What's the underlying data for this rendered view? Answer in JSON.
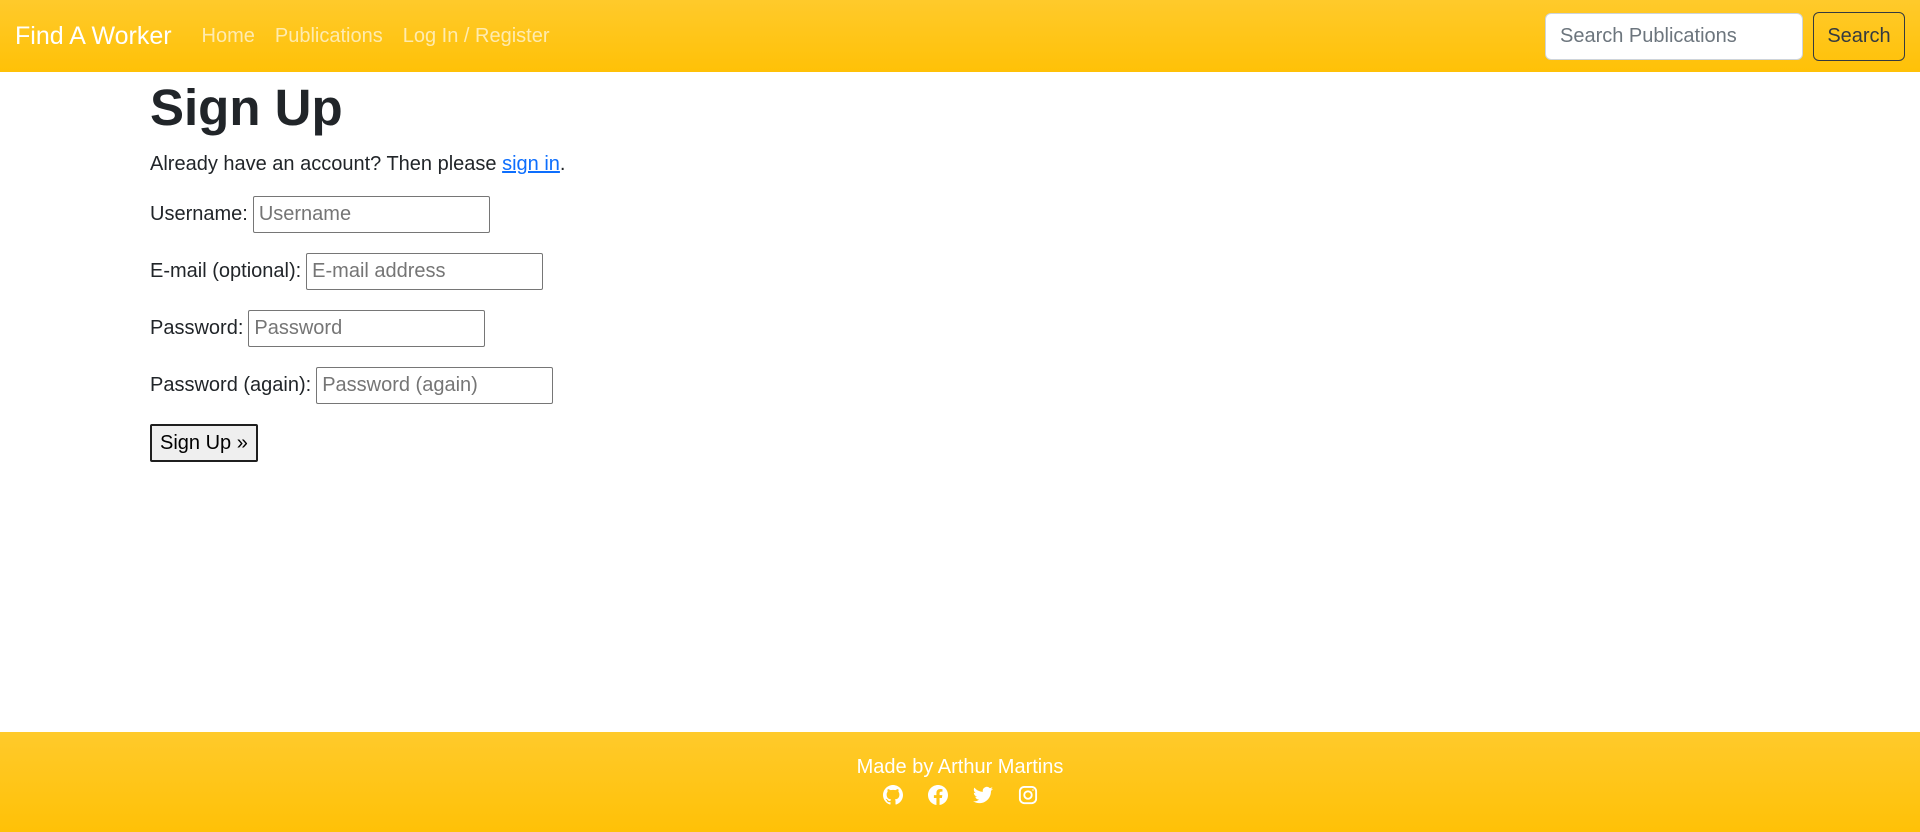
{
  "navbar": {
    "brand": "Find A Worker",
    "links": [
      "Home",
      "Publications",
      "Log In / Register"
    ],
    "search_placeholder": "Search Publications",
    "search_button": "Search"
  },
  "main": {
    "title": "Sign Up",
    "intro_prefix": "Already have an account? Then please ",
    "intro_link": "sign in",
    "intro_suffix": ".",
    "fields": [
      {
        "label": "Username:",
        "placeholder": "Username"
      },
      {
        "label": "E-mail (optional):",
        "placeholder": "E-mail address"
      },
      {
        "label": "Password:",
        "placeholder": "Password"
      },
      {
        "label": "Password (again):",
        "placeholder": "Password (again)"
      }
    ],
    "submit_label": "Sign Up »"
  },
  "footer": {
    "text": "Made by Arthur Martins",
    "icons": [
      "github-icon",
      "facebook-icon",
      "twitter-icon",
      "instagram-icon"
    ]
  },
  "colors": {
    "brand_yellow": "#ffc107",
    "link_blue": "#0d6efd"
  }
}
